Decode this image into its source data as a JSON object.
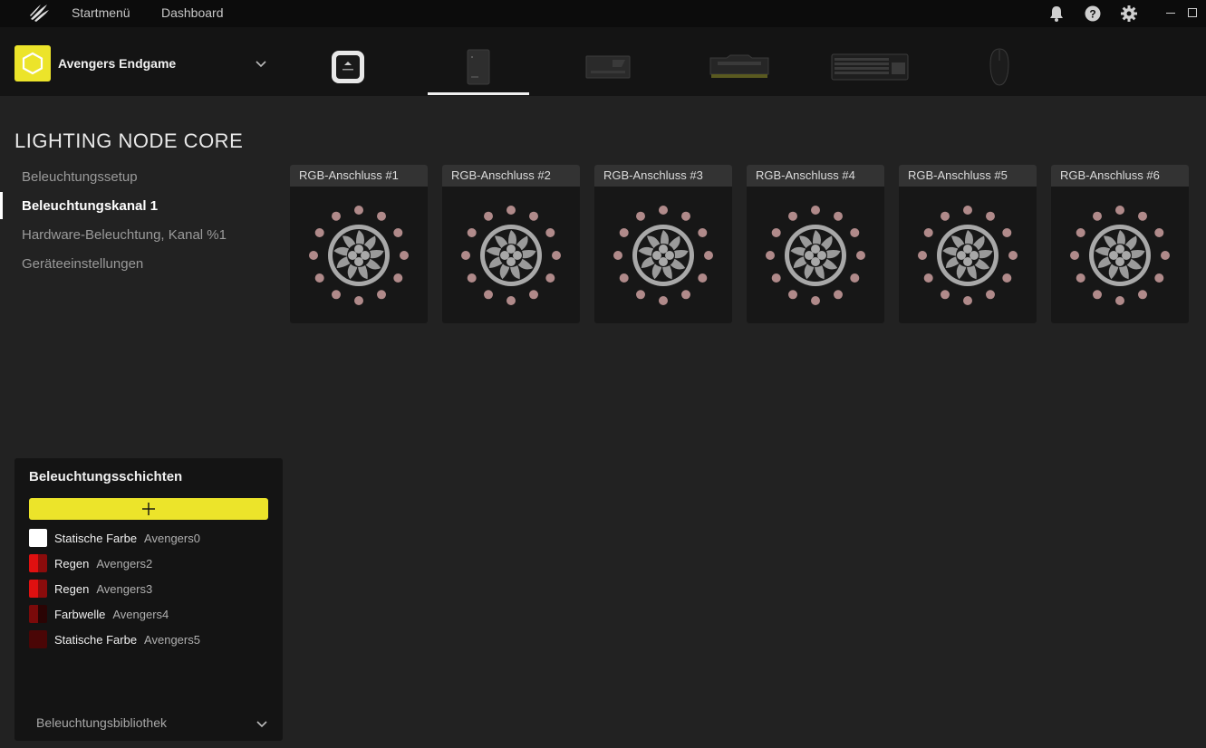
{
  "app": {
    "nav": [
      "Startmenü",
      "Dashboard"
    ]
  },
  "icons": {
    "logo": "corsair-sails-icon",
    "notifications": "bell-icon",
    "help": "question-icon",
    "settings": "gear-icon",
    "minimize": "minimize-icon",
    "maximize": "maximize-icon"
  },
  "profile": {
    "name": "Avengers Endgame",
    "badge_color": "#ece42a"
  },
  "devices": [
    {
      "name": "aio-cooler-pump",
      "selected": false
    },
    {
      "name": "lighting-node-core",
      "selected": true
    },
    {
      "name": "commander-hub",
      "selected": false
    },
    {
      "name": "ram-module",
      "selected": false
    },
    {
      "name": "keyboard",
      "selected": false
    },
    {
      "name": "mouse",
      "selected": false
    }
  ],
  "page": {
    "title": "LIGHTING NODE CORE"
  },
  "sidebar": {
    "items": [
      {
        "label": "Beleuchtungssetup",
        "active": false
      },
      {
        "label": "Beleuchtungskanal 1",
        "active": true
      },
      {
        "label": "Hardware-Beleuchtung, Kanal %1",
        "active": false
      },
      {
        "label": "Geräteeinstellungen",
        "active": false
      }
    ]
  },
  "ports": [
    {
      "label": "RGB-Anschluss #1"
    },
    {
      "label": "RGB-Anschluss #2"
    },
    {
      "label": "RGB-Anschluss #3"
    },
    {
      "label": "RGB-Anschluss #4"
    },
    {
      "label": "RGB-Anschluss #5"
    },
    {
      "label": "RGB-Anschluss #6"
    }
  ],
  "layers": {
    "title": "Beleuchtungsschichten",
    "add_icon": "plus-icon",
    "items": [
      {
        "type": "Statische Farbe",
        "name": "Avengers0",
        "colors": [
          "#ffffff"
        ]
      },
      {
        "type": "Regen",
        "name": "Avengers2",
        "colors": [
          "#e01010",
          "#8a0c0c"
        ]
      },
      {
        "type": "Regen",
        "name": "Avengers3",
        "colors": [
          "#e01010",
          "#8a0c0c"
        ]
      },
      {
        "type": "Farbwelle",
        "name": "Avengers4",
        "colors": [
          "#7a0a0a",
          "#2a0404"
        ]
      },
      {
        "type": "Statische Farbe",
        "name": "Avengers5",
        "colors": [
          "#4a0606"
        ]
      }
    ],
    "library_label": "Beleuchtungsbibliothek"
  },
  "colors": {
    "accent": "#ece42a",
    "led_dot": "#b08a8a"
  }
}
